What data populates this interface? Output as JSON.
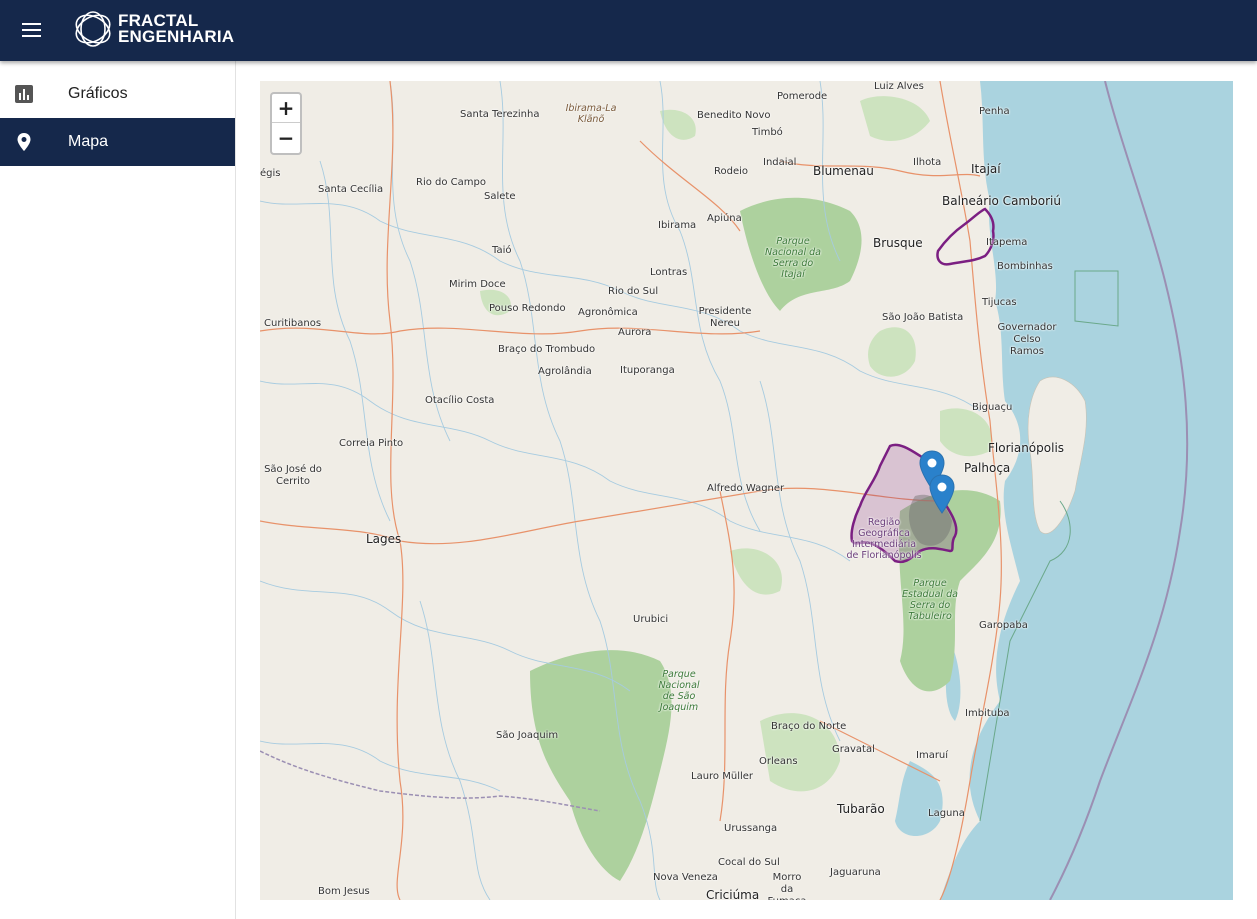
{
  "header": {
    "brand_line1": "FRACTAL",
    "brand_line2": "ENGENHARIA"
  },
  "sidebar": {
    "items": [
      {
        "label": "Gráficos",
        "icon": "bar-chart-icon"
      },
      {
        "label": "Mapa",
        "icon": "map-pin-icon"
      }
    ]
  },
  "map": {
    "zoom_in": "+",
    "zoom_out": "−",
    "places": {
      "luiz_alves": "Luiz Alves",
      "penha": "Penha",
      "pomerode": "Pomerode",
      "santa_terezinha": "Santa Terezinha",
      "ibirama_klano": "Ibirama-La Klãnõ",
      "benedito_novo": "Benedito Novo",
      "timbo": "Timbó",
      "itajai": "Itajaí",
      "ilhota": "Ilhota",
      "indaial": "Indaial",
      "rodeio": "Rodeio",
      "blumenau": "Blumenau",
      "santa_cecilia": "Santa Cecília",
      "rio_do_campo": "Rio do Campo",
      "salete": "Salete",
      "balneario": "Balneário Camboriú",
      "ibirama": "Ibirama",
      "apiuna": "Apiúna",
      "brusque": "Brusque",
      "itapema": "Itapema",
      "taio": "Taió",
      "bombinhas": "Bombinhas",
      "lontras": "Lontras",
      "mirim_doce": "Mirim Doce",
      "rio_do_sul": "Rio do Sul",
      "tijucas": "Tijucas",
      "pouso_redondo": "Pouso Redondo",
      "agronomica": "Agronômica",
      "presidente_nereu": "Presidente Nereu",
      "sao_joao_batista": "São João Batista",
      "curitibanos": "Curitibanos",
      "governador_celso_ramos": "Governador Celso Ramos",
      "aurora": "Aurora",
      "braco_do_trombudo": "Braço do Trombudo",
      "agrolandia": "Agrolândia",
      "ituporanga": "Ituporanga",
      "otacilio_costa": "Otacílio Costa",
      "biguacu": "Biguaçu",
      "correia_pinto": "Correia Pinto",
      "florianopolis": "Florianópolis",
      "sao_jose_do_cerrito": "São José do Cerrito",
      "palhoca": "Palhoça",
      "alfredo_wagner": "Alfredo Wagner",
      "lages": "Lages",
      "urubici": "Urubici",
      "garopaba": "Garopaba",
      "imbituba": "Imbituba",
      "braco_do_norte": "Braço do Norte",
      "sao_joaquim": "São Joaquim",
      "gravatal": "Gravatal",
      "imarui": "Imaruí",
      "lauro_muller": "Lauro Müller",
      "orleans": "Orleans",
      "tubarao": "Tubarão",
      "laguna": "Laguna",
      "urussanga": "Urussanga",
      "cocal_do_sul": "Cocal do Sul",
      "nova_veneza": "Nova Veneza",
      "morro_da_fumaca": "Morro da Fumaça",
      "jaguaruna": "Jaguaruna",
      "bom_jesus": "Bom Jesus",
      "criciuma": "Criciúma",
      "vargem_partial": "égis"
    },
    "parks": {
      "serra_itajai": "Parque Nacional da Serra do Itajaí",
      "serra_tabuleiro": "Parque Estadual da Serra do Tabuleiro",
      "sao_joaquim": "Parque Nacional de São Joaquim"
    },
    "region": "Região Geográfica Intermediária de Florianópolis",
    "colors": {
      "water": "#aad3df",
      "land": "#f0ede6",
      "forest": "#add19e",
      "region_border": "#7b1f82",
      "marker": "#2a81cb"
    }
  }
}
